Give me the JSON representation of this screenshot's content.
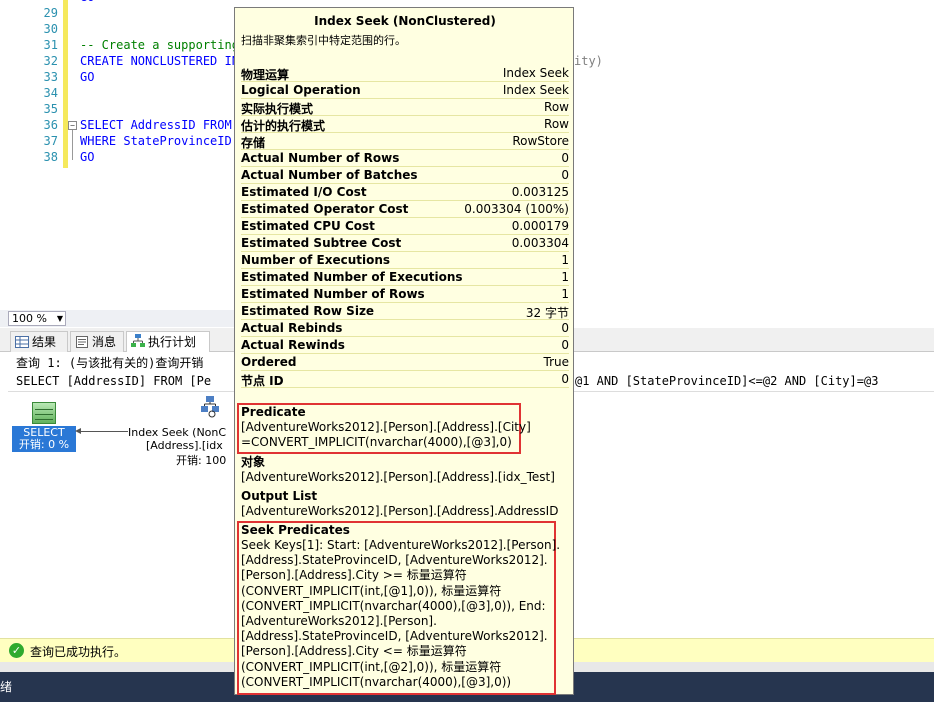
{
  "editor": {
    "line_numbers": [
      "29",
      "30",
      "31",
      "32",
      "33",
      "34",
      "35",
      "36",
      "37",
      "38"
    ],
    "lines": [
      {
        "num": "29",
        "text": ""
      },
      {
        "num": "30",
        "text": ""
      },
      {
        "num": "31",
        "text": "-- Create a supporting"
      },
      {
        "num": "32",
        "text": "CREATE NONCLUSTERED IN"
      },
      {
        "num": "33",
        "text": "GO"
      },
      {
        "num": "34",
        "text": ""
      },
      {
        "num": "35",
        "text": ""
      },
      {
        "num": "36",
        "text": "SELECT AddressID FROM"
      },
      {
        "num": "37",
        "text": "WHERE StateProvinceID"
      },
      {
        "num": "38",
        "text": "GO"
      }
    ],
    "top_clip": "GO",
    "line_32_right_fragment": "ity)"
  },
  "zoom": {
    "value": "100 %"
  },
  "tabs": [
    {
      "label": "结果",
      "icon": "grid-icon",
      "active": false
    },
    {
      "label": "消息",
      "icon": "message-icon",
      "active": false
    },
    {
      "label": "执行计划",
      "icon": "execution-plan-icon",
      "active": true
    }
  ],
  "plan": {
    "query_header": "查询 1: (与该批有关的)查询开销",
    "query_sql_left": "SELECT [AddressID] FROM [Pe",
    "query_sql_right": "@1 AND [StateProvinceID]<=@2 AND [City]=@3",
    "select_node": {
      "label": "SELECT",
      "cost_label": "开销: 0 %"
    },
    "seek_node": {
      "line1": "Index Seek (NonC",
      "line2": "[Address].[idx",
      "line3": "开销: 100"
    }
  },
  "tooltip": {
    "title": "Index Seek (NonClustered)",
    "subtitle": "扫描非聚集索引中特定范围的行。",
    "rows": [
      {
        "label": "物理运算",
        "value": "Index Seek"
      },
      {
        "label": "Logical Operation",
        "value": "Index Seek"
      },
      {
        "label": "实际执行模式",
        "value": "Row"
      },
      {
        "label": "估计的执行模式",
        "value": "Row"
      },
      {
        "label": "存储",
        "value": "RowStore"
      },
      {
        "label": "Actual Number of Rows",
        "value": "0"
      },
      {
        "label": "Actual Number of Batches",
        "value": "0"
      },
      {
        "label": "Estimated I/O Cost",
        "value": "0.003125"
      },
      {
        "label": "Estimated Operator Cost",
        "value": "0.003304 (100%)"
      },
      {
        "label": "Estimated CPU Cost",
        "value": "0.000179"
      },
      {
        "label": "Estimated Subtree Cost",
        "value": "0.003304"
      },
      {
        "label": "Number of Executions",
        "value": "1"
      },
      {
        "label": "Estimated Number of Executions",
        "value": "1"
      },
      {
        "label": "Estimated Number of Rows",
        "value": "1"
      },
      {
        "label": "Estimated Row Size",
        "value": "32 字节"
      },
      {
        "label": "Actual Rebinds",
        "value": "0"
      },
      {
        "label": "Actual Rewinds",
        "value": "0"
      },
      {
        "label": "Ordered",
        "value": "True"
      },
      {
        "label": "节点 ID",
        "value": "0"
      }
    ],
    "predicate": {
      "title": "Predicate",
      "lines": [
        "[AdventureWorks2012].[Person].[Address].[City]",
        "=CONVERT_IMPLICIT(nvarchar(4000),[@3],0)"
      ]
    },
    "object": {
      "title": "对象",
      "lines": [
        "[AdventureWorks2012].[Person].[Address].[idx_Test]"
      ]
    },
    "output_list": {
      "title": "Output List",
      "lines": [
        "[AdventureWorks2012].[Person].[Address].AddressID"
      ]
    },
    "seek_predicates": {
      "title": "Seek Predicates",
      "lines": [
        "Seek Keys[1]: Start: [AdventureWorks2012].[Person].",
        "[Address].StateProvinceID, [AdventureWorks2012].",
        "[Person].[Address].City >= 标量运算符",
        "(CONVERT_IMPLICIT(int,[@1],0)), 标量运算符",
        "(CONVERT_IMPLICIT(nvarchar(4000),[@3],0)), End:",
        "[AdventureWorks2012].[Person].",
        "[Address].StateProvinceID, [AdventureWorks2012].",
        "[Person].[Address].City <= 标量运算符",
        "(CONVERT_IMPLICIT(int,[@2],0)), 标量运算符",
        "(CONVERT_IMPLICIT(nvarchar(4000),[@3],0))"
      ]
    }
  },
  "status": {
    "text": "查询已成功执行。"
  },
  "taskbar": {
    "text": "绪"
  }
}
